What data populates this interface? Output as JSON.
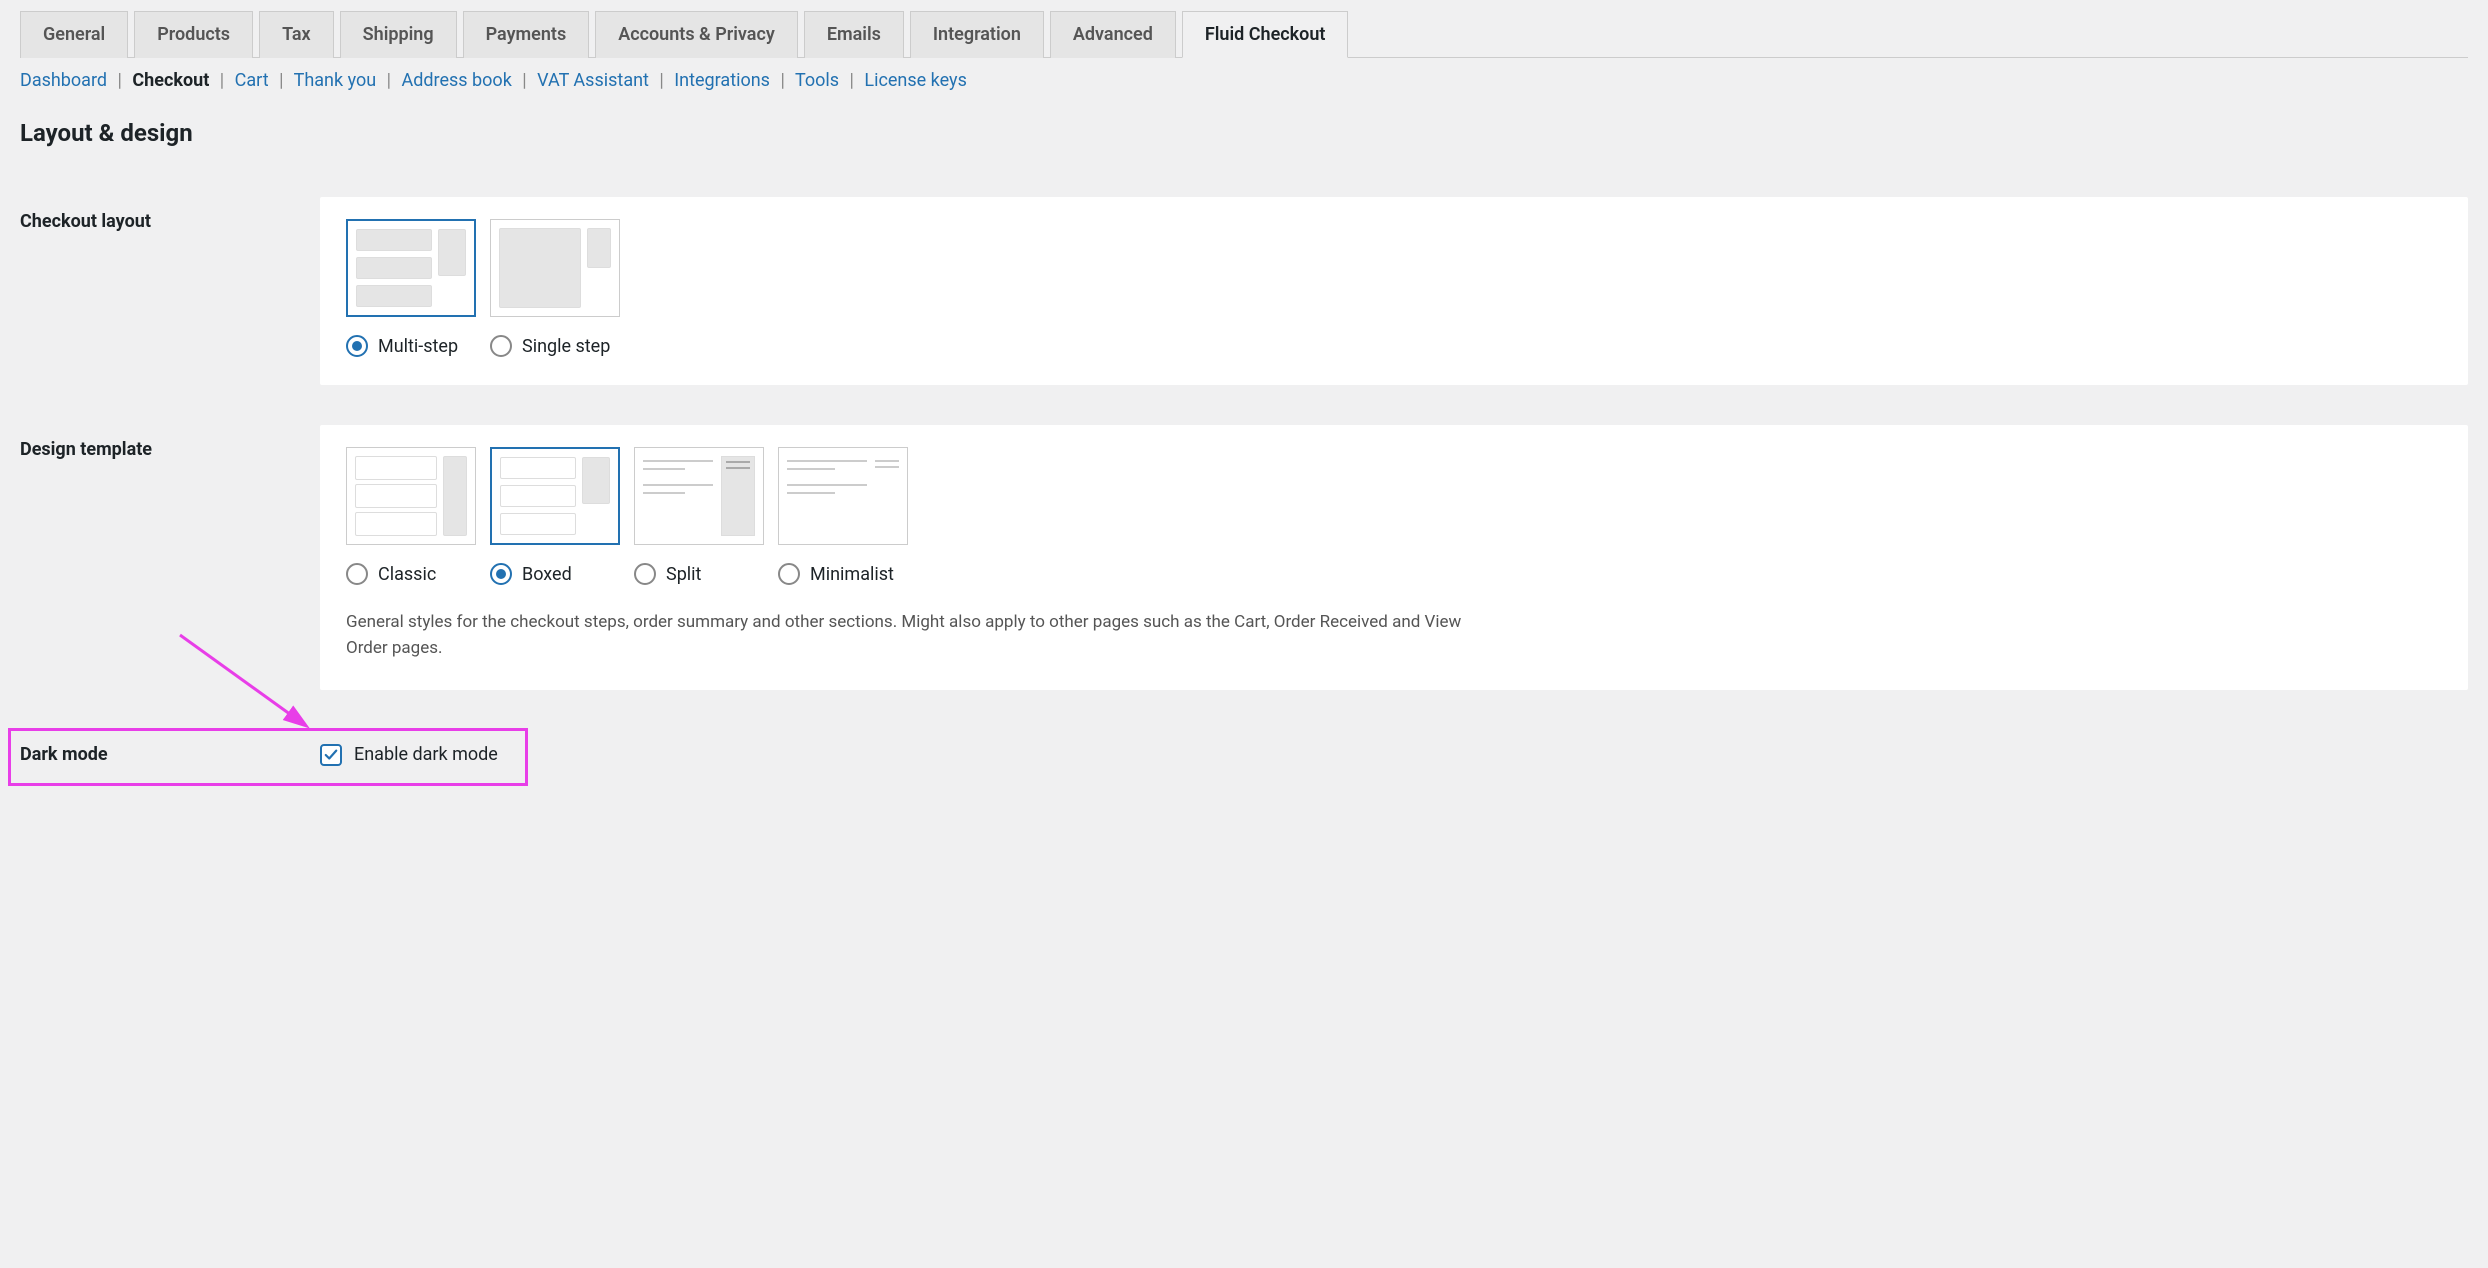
{
  "tabs": [
    {
      "label": "General",
      "active": false
    },
    {
      "label": "Products",
      "active": false
    },
    {
      "label": "Tax",
      "active": false
    },
    {
      "label": "Shipping",
      "active": false
    },
    {
      "label": "Payments",
      "active": false
    },
    {
      "label": "Accounts & Privacy",
      "active": false
    },
    {
      "label": "Emails",
      "active": false
    },
    {
      "label": "Integration",
      "active": false
    },
    {
      "label": "Advanced",
      "active": false
    },
    {
      "label": "Fluid Checkout",
      "active": true
    }
  ],
  "subnav": [
    {
      "label": "Dashboard",
      "current": false
    },
    {
      "label": "Checkout",
      "current": true
    },
    {
      "label": "Cart",
      "current": false
    },
    {
      "label": "Thank you",
      "current": false
    },
    {
      "label": "Address book",
      "current": false
    },
    {
      "label": "VAT Assistant",
      "current": false
    },
    {
      "label": "Integrations",
      "current": false
    },
    {
      "label": "Tools",
      "current": false
    },
    {
      "label": "License keys",
      "current": false
    }
  ],
  "heading": "Layout & design",
  "checkout_layout": {
    "label": "Checkout layout",
    "options": [
      {
        "label": "Multi-step",
        "selected": true
      },
      {
        "label": "Single step",
        "selected": false
      }
    ]
  },
  "design_template": {
    "label": "Design template",
    "options": [
      {
        "label": "Classic",
        "selected": false
      },
      {
        "label": "Boxed",
        "selected": true
      },
      {
        "label": "Split",
        "selected": false
      },
      {
        "label": "Minimalist",
        "selected": false
      }
    ],
    "help": "General styles for the checkout steps, order summary and other sections. Might also apply to other pages such as the Cart, Order Received and View Order pages."
  },
  "dark_mode": {
    "label": "Dark mode",
    "checkbox_label": "Enable dark mode",
    "checked": true
  }
}
